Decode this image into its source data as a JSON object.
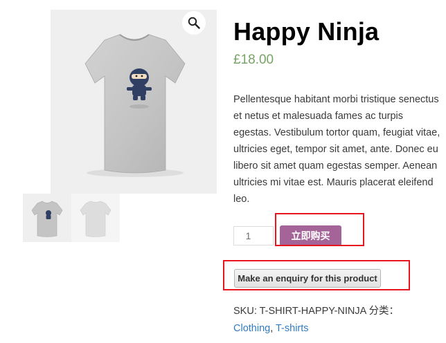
{
  "product": {
    "title": "Happy Ninja",
    "price": "£18.00",
    "description": "Pellentesque habitant morbi tristique senectus et netus et malesuada fames ac turpis egestas. Vestibulum tortor quam, feugiat vitae, ultricies eget, tempor sit amet, ante. Donec eu libero sit amet quam egestas semper. Aenean ultricies mi vitae est. Mauris placerat eleifend leo."
  },
  "gallery": {
    "zoom_icon": "magnifier-icon",
    "thumbnails": [
      {
        "name": "front",
        "icon": "tshirt-ninja-front"
      },
      {
        "name": "back",
        "icon": "tshirt-back"
      }
    ]
  },
  "cart": {
    "quantity": "1",
    "buy_label": "立即购买"
  },
  "enquiry": {
    "label": "Make an enquiry for this product"
  },
  "meta": {
    "sku_label": "SKU:",
    "sku_value": "T-SHIRT-HAPPY-NINJA",
    "category_label": "分类：",
    "categories": [
      "Clothing",
      "T-shirts"
    ],
    "separator": ", "
  },
  "colors": {
    "price": "#77a464",
    "buy_button": "#a46497",
    "link": "#2f7cc1",
    "highlight_box": "#e8161c"
  }
}
